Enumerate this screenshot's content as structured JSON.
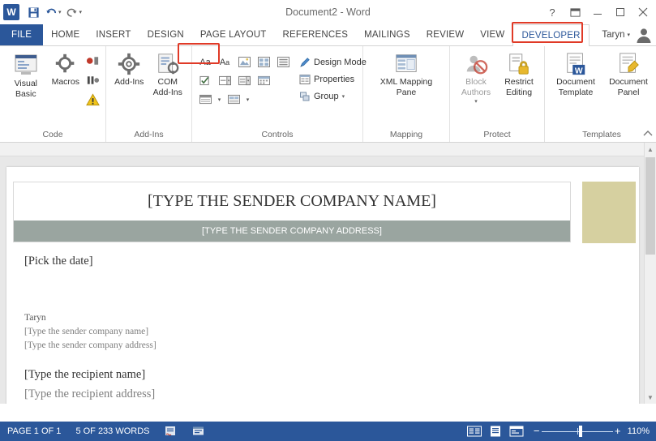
{
  "titlebar": {
    "app_icon": "word-logo",
    "doc_title": "Document2 - Word",
    "qat": [
      {
        "name": "save-button",
        "glyph": "💾"
      },
      {
        "name": "undo-button",
        "glyph": "↶"
      },
      {
        "name": "redo-button",
        "glyph": "↻"
      },
      {
        "name": "customize-qat-button",
        "glyph": "▾"
      }
    ],
    "window_buttons": [
      {
        "name": "help-button",
        "glyph": "?"
      },
      {
        "name": "ribbon-display-options-button",
        "glyph": "❐"
      },
      {
        "name": "minimize-button",
        "glyph": "—"
      },
      {
        "name": "restore-button",
        "glyph": "❐"
      },
      {
        "name": "close-button",
        "glyph": "✕"
      }
    ]
  },
  "tabs": {
    "file": "FILE",
    "items": [
      {
        "label": "HOME",
        "active": false
      },
      {
        "label": "INSERT",
        "active": false
      },
      {
        "label": "DESIGN",
        "active": false
      },
      {
        "label": "PAGE LAYOUT",
        "active": false
      },
      {
        "label": "REFERENCES",
        "active": false
      },
      {
        "label": "MAILINGS",
        "active": false
      },
      {
        "label": "REVIEW",
        "active": false
      },
      {
        "label": "VIEW",
        "active": false
      },
      {
        "label": "DEVELOPER",
        "active": true
      }
    ],
    "user_name": "Taryn",
    "highlight_color": "#e03a27"
  },
  "ribbon": {
    "groups": [
      {
        "label": "Code",
        "buttons": [
          {
            "name": "visual-basic-button",
            "line1": "Visual",
            "line2": "Basic"
          },
          {
            "name": "macros-button",
            "line1": "Macros",
            "line2": ""
          },
          {
            "name": "record-macro-button",
            "line1": "",
            "line2": ""
          },
          {
            "name": "macro-security-button",
            "line1": "",
            "line2": ""
          }
        ]
      },
      {
        "label": "Add-Ins",
        "buttons": [
          {
            "name": "add-ins-button",
            "line1": "Add-Ins",
            "line2": ""
          },
          {
            "name": "com-add-ins-button",
            "line1": "COM",
            "line2": "Add-Ins"
          }
        ]
      },
      {
        "label": "Controls",
        "items": [
          {
            "name": "rich-text-content-control",
            "glyph": "Aa"
          },
          {
            "name": "plain-text-content-control",
            "glyph": "Aa"
          },
          {
            "name": "picture-content-control",
            "glyph": "▣"
          },
          {
            "name": "building-block-gallery-control",
            "glyph": "☷"
          },
          {
            "name": "repeating-section-control",
            "glyph": "☰"
          },
          {
            "name": "checkbox-content-control",
            "glyph": "☑"
          },
          {
            "name": "combo-box-content-control",
            "glyph": "▤"
          },
          {
            "name": "drop-down-list-content-control",
            "glyph": "▥"
          },
          {
            "name": "date-picker-content-control",
            "glyph": "▦"
          },
          {
            "name": "legacy-tools-button",
            "glyph": "⌸"
          },
          {
            "name": "legacy-forms-button",
            "glyph": "▧"
          }
        ],
        "commands": [
          {
            "name": "design-mode-button",
            "label": "Design Mode",
            "icon": "pencil-icon"
          },
          {
            "name": "properties-button",
            "label": "Properties",
            "icon": "properties-icon"
          },
          {
            "name": "group-button",
            "label": "Group",
            "icon": "group-icon",
            "caret": "▾"
          }
        ]
      },
      {
        "label": "Mapping",
        "buttons": [
          {
            "name": "xml-mapping-pane-button",
            "line1": "XML Mapping",
            "line2": "Pane"
          }
        ]
      },
      {
        "label": "Protect",
        "buttons": [
          {
            "name": "block-authors-button",
            "line1": "Block",
            "line2": "Authors",
            "caret": "▾"
          },
          {
            "name": "restrict-editing-button",
            "line1": "Restrict",
            "line2": "Editing"
          }
        ]
      },
      {
        "label": "Templates",
        "buttons": [
          {
            "name": "document-template-button",
            "line1": "Document",
            "line2": "Template"
          },
          {
            "name": "document-panel-button",
            "line1": "Document",
            "line2": "Panel"
          }
        ]
      }
    ],
    "collapse_glyph": "⌃"
  },
  "document": {
    "company_name": "[TYPE THE SENDER COMPANY NAME]",
    "company_address": "[TYPE THE SENDER COMPANY ADDRESS]",
    "date_placeholder": "[Pick the date]",
    "sender_name": "Taryn",
    "sender_company": "[Type the sender company name]",
    "sender_address": "[Type the sender company address]",
    "recipient_name": "[Type the recipient name]",
    "recipient_address": "[Type the recipient address]",
    "address_band_color": "#9aa5a0",
    "logo_color": "#d6d0a0"
  },
  "statusbar": {
    "page_info": "PAGE 1 OF 1",
    "word_count": "5 OF 233 WORDS",
    "proofing_icon": "proofing-errors-icon",
    "language_icon": "language-icon",
    "views": [
      {
        "name": "read-mode-button",
        "glyph": "▤"
      },
      {
        "name": "print-layout-button",
        "glyph": "▦"
      },
      {
        "name": "web-layout-button",
        "glyph": "▧"
      }
    ],
    "zoom_out": "−",
    "zoom_in": "+",
    "zoom_level": "110%",
    "accent_color": "#2b579a"
  }
}
